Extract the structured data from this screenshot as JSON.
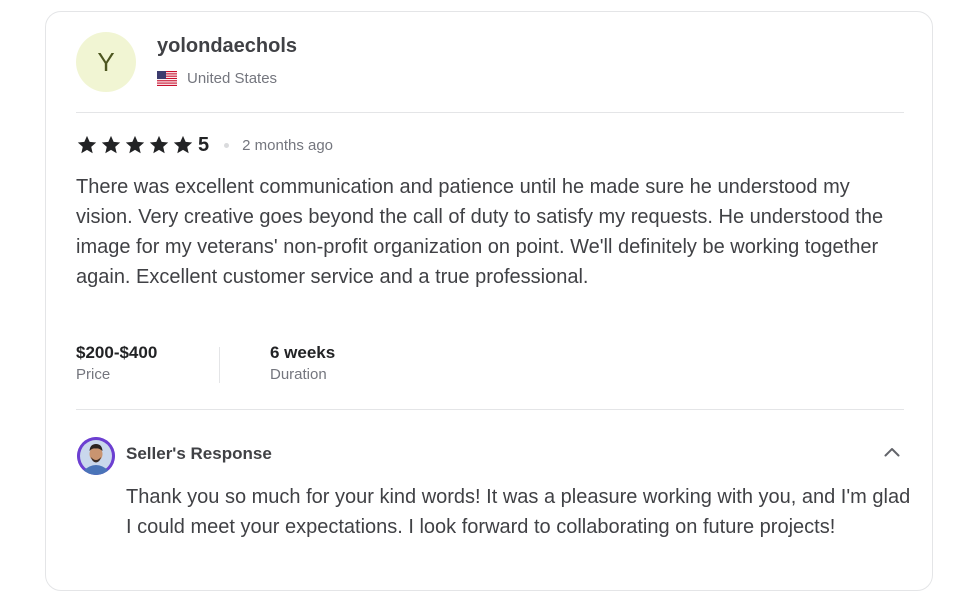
{
  "reviewer": {
    "avatar_initial": "Y",
    "username": "yolondaechols",
    "country": "United States",
    "flag_icon": "us-flag-icon"
  },
  "review": {
    "rating": "5",
    "stars": 5,
    "time_ago": "2 months ago",
    "text": "There was excellent communication and patience until he made sure he understood my vision. Very creative goes beyond the call of duty to satisfy my requests. He understood the image for my veterans' non-profit organization on point. We'll definitely be working together again. Excellent customer service and a true professional.",
    "price": {
      "value": "$200-$400",
      "label": "Price"
    },
    "duration": {
      "value": "6 weeks",
      "label": "Duration"
    }
  },
  "seller_response": {
    "title": "Seller's Response",
    "text": "Thank you so much for your kind words! It was a pleasure working with you, and I'm glad I could meet your expectations. I look forward to collaborating on future projects!",
    "collapse_icon": "chevron-up-icon"
  },
  "colors": {
    "avatar_bg": "#f1f5d3",
    "seller_avatar_ring": "#6c3fd1",
    "text_primary": "#404145",
    "text_secondary": "#74767e",
    "divider": "#e4e5e7"
  }
}
